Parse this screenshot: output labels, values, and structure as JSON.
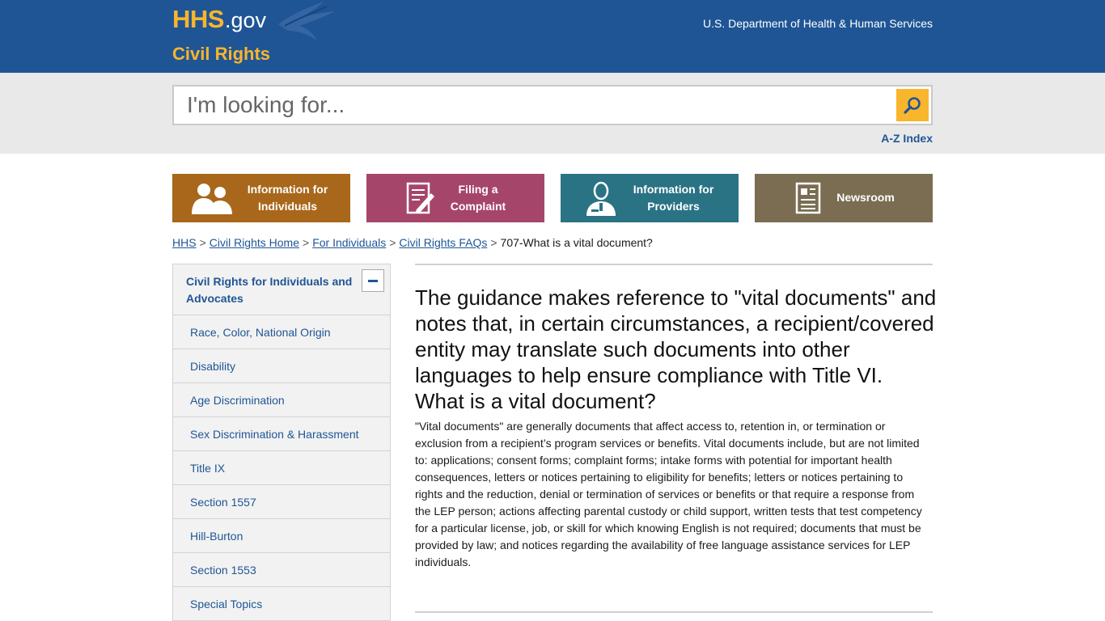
{
  "header": {
    "logo_main": "HHS",
    "logo_suffix": ".gov",
    "site_name": "Civil Rights",
    "department": "U.S. Department of Health & Human Services",
    "icons": {
      "logo_mark": "eagle-icon"
    }
  },
  "search": {
    "placeholder": "I'm looking for...",
    "value": "",
    "button_icon": "search-icon",
    "az_index": "A-Z Index"
  },
  "tiles": [
    {
      "label_line1": "Information for",
      "label_line2": "Individuals",
      "icon": "people-icon",
      "color": "#a8671a"
    },
    {
      "label_line1": "Filing a",
      "label_line2": "Complaint",
      "icon": "document-pen-icon",
      "color": "#a6456a"
    },
    {
      "label_line1": "Information for",
      "label_line2": "Providers",
      "icon": "provider-icon",
      "color": "#2a7384"
    },
    {
      "label_line1": "Newsroom",
      "label_line2": "",
      "icon": "newspaper-icon",
      "color": "#7a6d52"
    }
  ],
  "breadcrumb": {
    "items": [
      "HHS",
      "Civil Rights Home",
      "For Individuals",
      "Civil Rights FAQs"
    ],
    "separator": ">",
    "current": "707-What is a vital document?"
  },
  "sidebar": {
    "heading": "Civil Rights for Individuals and Advocates",
    "toggle_icon": "minus-icon",
    "items": [
      "Race, Color, National Origin",
      "Disability",
      "Age Discrimination",
      "Sex Discrimination & Harassment",
      "Title IX",
      "Section 1557",
      "Hill-Burton",
      "Section 1553",
      "Special Topics"
    ]
  },
  "content": {
    "question": "The guidance makes reference to \"vital documents\" and notes that, in certain circumstances, a recipient/covered entity may translate such documents into other languages to help ensure compliance with Title VI. What is a vital document?",
    "answer": "\"Vital documents\" are generally documents that affect access to, retention in, or termination or exclusion from a recipient’s program services or benefits. Vital documents include, but are not limited to: applications; consent forms; complaint forms; intake forms with potential for important health consequences, letters or notices pertaining to eligibility for benefits; letters or notices pertaining to rights and the reduction, denial or termination of services or benefits or that require a response from the LEP person; actions affecting parental custody or child support, written tests that test competency for a particular license, job, or skill for which knowing English is not required; documents that must be provided by law; and notices regarding the availability of free language assistance services for LEP individuals."
  },
  "colors": {
    "header_bg": "#1f5595",
    "brand_gold": "#f9b52c",
    "search_band": "#e9e9ea",
    "link": "#1f5595"
  }
}
